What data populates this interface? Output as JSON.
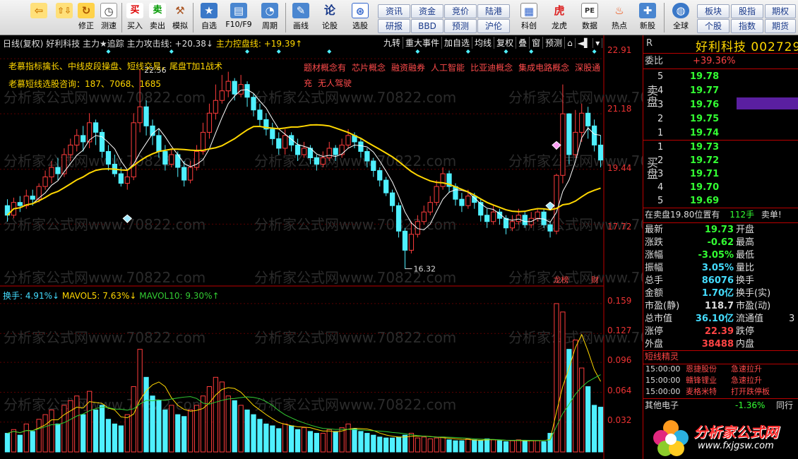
{
  "toolbar": {
    "buttons": [
      {
        "label": "",
        "icon": "back-arrow-icon"
      },
      {
        "label": "修正",
        "icon": "correct-icon"
      },
      {
        "label": "测速",
        "icon": "clock-icon"
      },
      {
        "label": "买入",
        "icon": "buy-icon",
        "glyph": "买"
      },
      {
        "label": "卖出",
        "icon": "sell-icon",
        "glyph": "卖"
      },
      {
        "label": "模拟",
        "icon": "hammer-icon"
      },
      {
        "label": "自选",
        "icon": "star-icon"
      },
      {
        "label": "F10/F9",
        "icon": "f10-icon"
      },
      {
        "label": "周期",
        "icon": "period-icon"
      },
      {
        "label": "画线",
        "icon": "pen-icon"
      },
      {
        "label": "论股",
        "icon": "forum-icon",
        "glyph": "论"
      },
      {
        "label": "选股",
        "icon": "pick-icon"
      },
      {
        "label": "科创",
        "icon": "sci-board-icon"
      },
      {
        "label": "龙虎",
        "icon": "dragon-tiger-icon"
      },
      {
        "label": "数据",
        "icon": "pe-icon",
        "glyph": "PE"
      },
      {
        "label": "热点",
        "icon": "hot-icon"
      },
      {
        "label": "新股",
        "icon": "ipo-icon"
      },
      {
        "label": "全球",
        "icon": "globe-icon"
      }
    ],
    "small_buttons": [
      "资讯",
      "资金",
      "竞价",
      "陆港",
      "研报",
      "BBD",
      "预测",
      "沪伦",
      "板块",
      "股指",
      "期权",
      "个股",
      "指数",
      "期货"
    ]
  },
  "chart": {
    "header": {
      "period": "日线(复权)",
      "stock": "好利科技",
      "indicator": "主力★追踪",
      "attack_label": "主力攻击线:",
      "attack_value": "+20.38↓",
      "control_label": "主力控盘线:",
      "control_value": "+19.39↑"
    },
    "toolbar": [
      "九转",
      "重大事件",
      "加自选",
      "均线",
      "复权",
      "叠",
      "窗",
      "预测",
      "⌂",
      "◄▌",
      "▾"
    ],
    "note1": "老慕指标擒长、中线皮段操盘、短线交易，尾盘T加1战术",
    "note2": "老慕短线选股咨询：187、7068、1685",
    "concepts": [
      "题材概念有",
      "芯片概念",
      "融资融券",
      "人工智能",
      "比亚迪概念",
      "集成电路概念",
      "深股通",
      "充",
      "无人驾驶"
    ],
    "price_axis": [
      "22.91",
      "21.18",
      "19.44",
      "17.72"
    ],
    "high_label": "22.56",
    "low_label": "16.32",
    "marker_top": "龙榜",
    "marker_fin": "财",
    "vol_header": {
      "turnover": "换手: 4.91%↓",
      "mavol5": "MAVOL5: 7.63%↓",
      "mavol10": "MAVOL10: 9.30%↑"
    },
    "vol_axis": [
      "0.159",
      "0.127",
      "0.096",
      "0.064",
      "0.032"
    ],
    "watermark": "分析家公式网www.70822.com"
  },
  "chart_data": {
    "type": "bar",
    "price_range": [
      16.0,
      23.2
    ],
    "volume_range": [
      0,
      0.165
    ],
    "candles": [
      [
        18.3,
        18.0,
        18.5,
        17.8
      ],
      [
        18.0,
        18.4,
        18.55,
        17.9
      ],
      [
        18.4,
        18.3,
        18.6,
        18.1
      ],
      [
        18.3,
        18.6,
        18.8,
        18.2
      ],
      [
        18.6,
        18.5,
        18.8,
        18.3
      ],
      [
        18.5,
        18.9,
        19.0,
        18.4
      ],
      [
        18.9,
        19.2,
        19.4,
        18.8
      ],
      [
        19.2,
        19.5,
        19.7,
        19.0
      ],
      [
        19.5,
        19.3,
        19.8,
        19.1
      ],
      [
        19.3,
        19.9,
        20.1,
        19.2
      ],
      [
        19.9,
        20.2,
        20.4,
        19.7
      ],
      [
        20.2,
        20.5,
        20.7,
        20.0
      ],
      [
        20.5,
        20.3,
        20.8,
        20.0
      ],
      [
        20.3,
        20.9,
        21.2,
        20.1
      ],
      [
        20.9,
        20.6,
        21.0,
        20.2
      ],
      [
        20.6,
        20.0,
        20.7,
        19.8
      ],
      [
        20.0,
        19.6,
        20.2,
        19.4
      ],
      [
        19.6,
        19.3,
        19.9,
        19.2
      ],
      [
        19.3,
        19.0,
        19.5,
        18.9
      ],
      [
        19.0,
        19.2,
        19.4,
        18.8
      ],
      [
        19.2,
        20.9,
        21.2,
        19.1
      ],
      [
        20.9,
        21.4,
        22.56,
        20.6
      ],
      [
        21.4,
        20.8,
        21.6,
        20.5
      ],
      [
        20.8,
        20.5,
        21.0,
        20.2
      ],
      [
        20.5,
        20.0,
        20.7,
        19.8
      ],
      [
        20.0,
        19.6,
        20.2,
        19.4
      ],
      [
        19.6,
        19.9,
        20.1,
        19.5
      ],
      [
        19.9,
        19.5,
        20.0,
        19.2
      ],
      [
        19.5,
        19.1,
        19.7,
        18.9
      ],
      [
        19.1,
        19.5,
        19.7,
        19.0
      ],
      [
        19.5,
        20.0,
        20.2,
        19.4
      ],
      [
        20.0,
        20.6,
        20.9,
        19.9
      ],
      [
        20.6,
        21.2,
        21.5,
        20.4
      ],
      [
        21.2,
        21.6,
        22.1,
        21.0
      ],
      [
        21.6,
        21.9,
        22.4,
        21.5
      ],
      [
        21.9,
        22.2,
        22.5,
        21.7
      ],
      [
        22.2,
        21.8,
        22.3,
        21.6
      ],
      [
        21.8,
        22.1,
        22.4,
        21.7
      ],
      [
        22.1,
        21.7,
        22.2,
        21.4
      ],
      [
        21.7,
        21.3,
        21.8,
        21.1
      ],
      [
        21.3,
        21.0,
        21.5,
        20.8
      ],
      [
        21.0,
        20.7,
        21.2,
        20.5
      ],
      [
        20.7,
        20.4,
        20.9,
        20.2
      ],
      [
        20.4,
        20.1,
        20.6,
        19.9
      ],
      [
        20.1,
        20.5,
        20.7,
        19.9
      ],
      [
        20.5,
        20.2,
        20.6,
        20.0
      ],
      [
        20.2,
        19.9,
        20.4,
        19.7
      ],
      [
        19.9,
        20.1,
        20.3,
        19.8
      ],
      [
        20.1,
        19.8,
        20.2,
        19.6
      ],
      [
        19.8,
        19.6,
        19.9,
        19.4
      ],
      [
        19.6,
        19.8,
        20.0,
        19.5
      ],
      [
        19.8,
        20.1,
        20.3,
        19.7
      ],
      [
        20.1,
        19.9,
        20.2,
        19.7
      ],
      [
        19.9,
        20.2,
        20.4,
        19.8
      ],
      [
        20.2,
        20.5,
        20.7,
        20.1
      ],
      [
        20.5,
        20.3,
        20.6,
        20.1
      ],
      [
        20.3,
        20.0,
        20.4,
        19.8
      ],
      [
        20.0,
        19.7,
        20.1,
        19.5
      ],
      [
        19.7,
        19.4,
        19.8,
        19.2
      ],
      [
        19.4,
        19.1,
        19.5,
        18.9
      ],
      [
        19.1,
        18.7,
        19.2,
        18.6
      ],
      [
        18.7,
        18.3,
        18.8,
        18.1
      ],
      [
        18.3,
        17.5,
        18.4,
        17.3
      ],
      [
        17.5,
        16.9,
        17.6,
        16.32
      ],
      [
        16.9,
        17.4,
        17.8,
        16.8
      ],
      [
        17.4,
        17.8,
        18.0,
        17.3
      ],
      [
        17.8,
        18.1,
        18.3,
        17.7
      ],
      [
        18.1,
        18.4,
        18.6,
        18.0
      ],
      [
        18.4,
        18.9,
        19.1,
        18.3
      ],
      [
        18.9,
        19.3,
        19.5,
        18.8
      ],
      [
        19.3,
        18.9,
        19.4,
        18.7
      ],
      [
        18.9,
        18.5,
        19.0,
        18.3
      ],
      [
        18.5,
        18.3,
        18.7,
        18.1
      ],
      [
        18.3,
        18.6,
        18.8,
        18.2
      ],
      [
        18.6,
        18.4,
        18.7,
        18.2
      ],
      [
        18.4,
        18.0,
        18.5,
        17.8
      ],
      [
        18.0,
        17.8,
        18.2,
        17.6
      ],
      [
        17.8,
        18.1,
        18.3,
        17.7
      ],
      [
        18.1,
        17.9,
        18.2,
        17.7
      ],
      [
        17.9,
        17.6,
        18.0,
        17.4
      ],
      [
        17.6,
        17.8,
        18.0,
        17.5
      ],
      [
        17.8,
        18.0,
        18.2,
        17.7
      ],
      [
        18.0,
        17.7,
        18.1,
        17.6
      ],
      [
        17.7,
        17.9,
        18.1,
        17.6
      ],
      [
        17.9,
        18.1,
        18.2,
        17.8
      ],
      [
        18.1,
        17.7,
        18.2,
        17.6
      ],
      [
        17.7,
        17.5,
        17.8,
        17.3
      ],
      [
        17.5,
        19.25,
        19.3,
        17.4
      ],
      [
        19.25,
        21.18,
        22.1,
        19.0
      ],
      [
        21.18,
        19.9,
        21.2,
        19.6
      ],
      [
        19.9,
        20.6,
        21.3,
        19.8
      ],
      [
        20.6,
        21.2,
        21.5,
        20.3
      ],
      [
        21.2,
        20.8,
        21.4,
        20.4
      ],
      [
        20.8,
        20.2,
        21.0,
        20.0
      ],
      [
        20.2,
        19.73,
        20.5,
        19.5
      ]
    ],
    "volumes": [
      0.02,
      0.024,
      0.018,
      0.03,
      0.022,
      0.035,
      0.04,
      0.045,
      0.03,
      0.05,
      0.055,
      0.06,
      0.04,
      0.065,
      0.045,
      0.05,
      0.035,
      0.03,
      0.028,
      0.04,
      0.07,
      0.11,
      0.08,
      0.06,
      0.055,
      0.045,
      0.05,
      0.04,
      0.038,
      0.045,
      0.05,
      0.06,
      0.07,
      0.08,
      0.075,
      0.06,
      0.055,
      0.05,
      0.045,
      0.04,
      0.035,
      0.03,
      0.028,
      0.025,
      0.03,
      0.028,
      0.024,
      0.026,
      0.022,
      0.02,
      0.02,
      0.024,
      0.022,
      0.026,
      0.03,
      0.025,
      0.022,
      0.02,
      0.018,
      0.016,
      0.015,
      0.015,
      0.016,
      0.018,
      0.02,
      0.015,
      0.016,
      0.014,
      0.015,
      0.016,
      0.013,
      0.012,
      0.012,
      0.014,
      0.013,
      0.012,
      0.014,
      0.013,
      0.012,
      0.011,
      0.012,
      0.013,
      0.012,
      0.012,
      0.012,
      0.011,
      0.02,
      0.159,
      0.15,
      0.11,
      0.12,
      0.09,
      0.07,
      0.05,
      0.048
    ],
    "ma_fast": [],
    "ma_slow": []
  },
  "panel": {
    "stock_r": "R",
    "stock_title": "好利科技 002729",
    "webi_label": "委比",
    "webi_value": "+39.36%",
    "sell_label": "卖盘",
    "buy_label": "买盘",
    "sell": [
      {
        "n": "5",
        "p": "19.78"
      },
      {
        "n": "4",
        "p": "19.77"
      },
      {
        "n": "3",
        "p": "19.76"
      },
      {
        "n": "2",
        "p": "19.75"
      },
      {
        "n": "1",
        "p": "19.74"
      }
    ],
    "buy": [
      {
        "n": "1",
        "p": "19.73"
      },
      {
        "n": "2",
        "p": "19.72"
      },
      {
        "n": "3",
        "p": "19.71"
      },
      {
        "n": "4",
        "p": "19.70"
      },
      {
        "n": "5",
        "p": "19.69"
      }
    ],
    "order_msg": "在卖盘19.80位置有",
    "order_qty": "112手",
    "order_tail": "卖单!",
    "stats": [
      {
        "l1": "最新",
        "v1": "19.73",
        "l2": "开盘",
        "v2": "",
        "c": "g"
      },
      {
        "l1": "涨跌",
        "v1": "-0.62",
        "l2": "最高",
        "v2": "",
        "c": "g"
      },
      {
        "l1": "涨幅",
        "v1": "-3.05%",
        "l2": "最低",
        "v2": "",
        "c": "g"
      },
      {
        "l1": "振幅",
        "v1": "3.05%",
        "l2": "量比",
        "v2": "",
        "c": "c"
      },
      {
        "l1": "总手",
        "v1": "86076",
        "l2": "换手",
        "v2": "",
        "c": "c"
      },
      {
        "l1": "金额",
        "v1": "1.70亿",
        "l2": "换手(实)",
        "v2": "",
        "c": "c"
      },
      {
        "l1": "市盈(静)",
        "v1": "118.7",
        "l2": "市盈(动)",
        "v2": "",
        "c": "w"
      },
      {
        "l1": "总市值",
        "v1": "36.10亿",
        "l2": "流通值",
        "v2": "3",
        "c": "c"
      },
      {
        "l1": "涨停",
        "v1": "22.39",
        "l2": "跌停",
        "v2": "",
        "c": "r"
      },
      {
        "l1": "外盘",
        "v1": "38488",
        "l2": "内盘",
        "v2": "",
        "c": "r"
      }
    ],
    "shortline_title": "短线精灵",
    "shortline": [
      {
        "t": "15:00:00",
        "s": "恩捷股份",
        "e": "急速拉升"
      },
      {
        "t": "15:00:00",
        "s": "赣锋锂业",
        "e": "急速拉升"
      },
      {
        "t": "15:00:00",
        "s": "麦格米特",
        "e": "打开跌停板"
      }
    ],
    "other_label": "其他电子",
    "other_value": "-1.36%",
    "other_tab": "同行"
  },
  "logo": {
    "name": "分析家公式网",
    "url": "www.fxjgsw.com"
  }
}
